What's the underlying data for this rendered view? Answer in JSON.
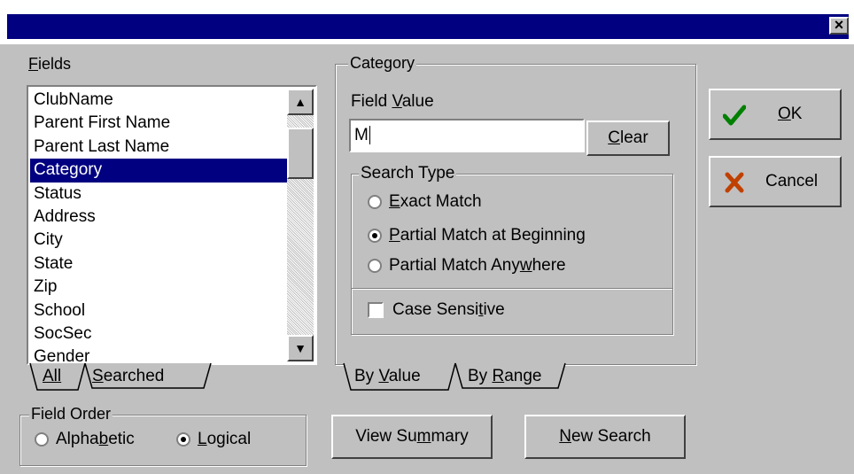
{
  "dialog": {
    "close_label": "×"
  },
  "fields": {
    "label": "Fields",
    "items": [
      "ClubName",
      "Parent First Name",
      "Parent Last Name",
      "Category",
      "Status",
      "Address",
      "City",
      "State",
      "Zip",
      "School",
      "SocSec",
      "Gender"
    ],
    "selected": "Category",
    "tabs": [
      "All",
      "Searched"
    ]
  },
  "field_order": {
    "label": "Field Order",
    "options": [
      "Alphabetic",
      "Logical"
    ],
    "selected": "Logical"
  },
  "category": {
    "group_label": "Category",
    "field_value_label": "Field Value",
    "field_value": "M",
    "clear_label": "Clear",
    "search_type": {
      "label": "Search Type",
      "options": [
        "Exact Match",
        "Partial Match at Beginning",
        "Partial Match Anywhere"
      ],
      "selected": "Partial Match at Beginning"
    },
    "case_sensitive_label": "Case Sensitive",
    "case_sensitive": false,
    "tabs": [
      "By Value",
      "By Range"
    ]
  },
  "buttons": {
    "ok": "OK",
    "cancel": "Cancel",
    "view_summary": "View Summary",
    "new_search": "New Search"
  },
  "icons": {
    "ok": "green-check-icon",
    "cancel": "red-x-icon"
  },
  "colors": {
    "selection": "#000080",
    "ok_icon": "#008000",
    "cancel_icon": "#c04000"
  }
}
